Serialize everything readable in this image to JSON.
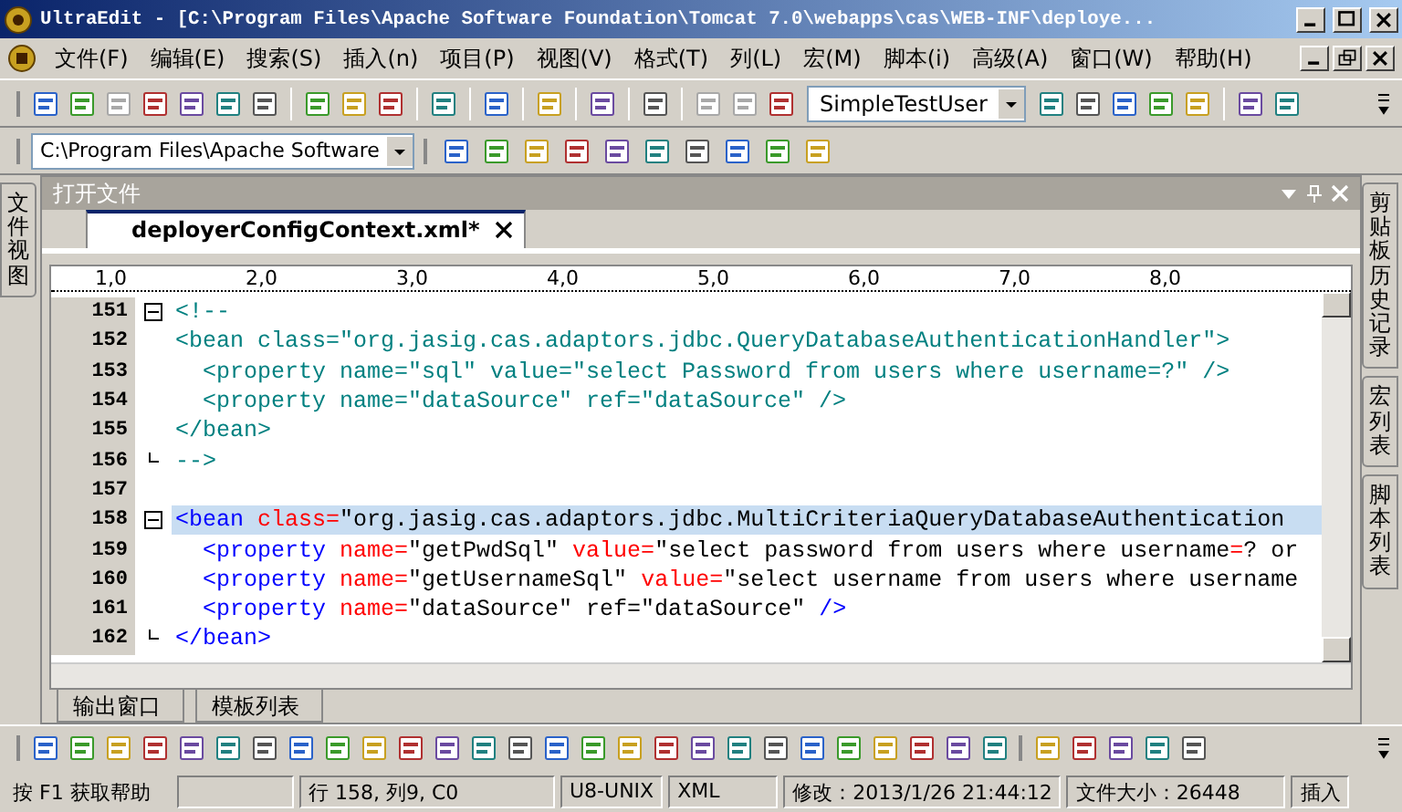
{
  "window": {
    "title": "UltraEdit - [C:\\Program Files\\Apache Software Foundation\\Tomcat 7.0\\webapps\\cas\\WEB-INF\\deploye..."
  },
  "menu": [
    "文件(F)",
    "编辑(E)",
    "搜索(S)",
    "插入(n)",
    "项目(P)",
    "视图(V)",
    "格式(T)",
    "列(L)",
    "宏(M)",
    "脚本(i)",
    "高级(A)",
    "窗口(W)",
    "帮助(H)"
  ],
  "toolbar": {
    "user_dropdown": "SimpleTestUser",
    "path_dropdown": "C:\\Program Files\\Apache Software"
  },
  "left_panel_tabs": [
    {
      "label": "文件视图",
      "selected": false
    }
  ],
  "right_panel_tabs": [
    {
      "label": "剪贴板历史记录",
      "selected": false
    },
    {
      "label": "宏列表",
      "selected": false
    },
    {
      "label": "脚本列表",
      "selected": false
    }
  ],
  "open_files_panel": {
    "title": "打开文件",
    "tabs": [
      {
        "label": "deployerConfigContext.xml*",
        "selected": true
      }
    ]
  },
  "ruler": [
    "1,0",
    "2,0",
    "3,0",
    "4,0",
    "5,0",
    "6,0",
    "7,0",
    "8,0"
  ],
  "editor": {
    "lines": [
      {
        "number": "151",
        "kind": "fold_start",
        "current": false,
        "tokens": [
          {
            "kind": "comment",
            "text": "<!--"
          }
        ]
      },
      {
        "number": "152",
        "kind": "plain",
        "current": false,
        "tokens": [
          {
            "kind": "comment",
            "text": "<bean class=\"org.jasig.cas.adaptors.jdbc.QueryDatabaseAuthenticationHandler\">"
          }
        ]
      },
      {
        "number": "153",
        "kind": "plain",
        "current": false,
        "tokens": [
          {
            "kind": "comment",
            "text": "  <property name=\"sql\" value=\"select Password from users where username=?\" />"
          }
        ]
      },
      {
        "number": "154",
        "kind": "plain",
        "current": false,
        "tokens": [
          {
            "kind": "comment",
            "text": "  <property name=\"dataSource\" ref=\"dataSource\" />"
          }
        ]
      },
      {
        "number": "155",
        "kind": "plain",
        "current": false,
        "tokens": [
          {
            "kind": "comment",
            "text": "</bean>"
          }
        ]
      },
      {
        "number": "156",
        "kind": "fold_end",
        "current": false,
        "tokens": [
          {
            "kind": "comment",
            "text": "-->"
          }
        ]
      },
      {
        "number": "157",
        "kind": "plain",
        "current": false
      },
      {
        "number": "158",
        "kind": "fold_start",
        "current": true,
        "tokens": [
          {
            "kind": "tag",
            "text": "<bean "
          },
          {
            "kind": "attr",
            "text": "class="
          },
          {
            "kind": "value",
            "text": "\"org.jasig.cas.adaptors.jdbc.MultiCriteriaQueryDatabaseAuthentication"
          }
        ]
      },
      {
        "number": "159",
        "kind": "plain",
        "current": false,
        "tokens": [
          {
            "kind": "tag",
            "text": "  <property "
          },
          {
            "kind": "attr",
            "text": "name="
          },
          {
            "kind": "value",
            "text": "\"getPwdSql\" "
          },
          {
            "kind": "attr",
            "text": "value="
          },
          {
            "kind": "value",
            "text": "\"select password from users where username"
          },
          {
            "kind": "attr",
            "text": "="
          },
          {
            "kind": "value",
            "text": "? or"
          }
        ]
      },
      {
        "number": "160",
        "kind": "plain",
        "current": false,
        "tokens": [
          {
            "kind": "tag",
            "text": "  <property "
          },
          {
            "kind": "attr",
            "text": "name="
          },
          {
            "kind": "value",
            "text": "\"getUsernameSql\" "
          },
          {
            "kind": "attr",
            "text": "value="
          },
          {
            "kind": "value",
            "text": "\"select username from users where username"
          }
        ]
      },
      {
        "number": "161",
        "kind": "plain",
        "current": false,
        "tokens": [
          {
            "kind": "tag",
            "text": "  <property "
          },
          {
            "kind": "attr",
            "text": "name="
          },
          {
            "kind": "value",
            "text": "\"dataSource\" ref=\"dataSource\" "
          },
          {
            "kind": "tag",
            "text": "/>"
          }
        ]
      },
      {
        "number": "162",
        "kind": "fold_end",
        "current": false,
        "tokens": [
          {
            "kind": "tag",
            "text": "</bean>"
          }
        ]
      }
    ]
  },
  "bottom_tabs": [
    {
      "label": "输出窗口",
      "selected": false
    },
    {
      "label": "模板列表",
      "selected": false
    }
  ],
  "status_bar": [
    "按 F1 获取帮助",
    "行 158, 列9, C0",
    "U8-UNIX",
    "XML",
    "修改：2013/1/26 21:44:12",
    "文件大小：26448",
    "插入"
  ]
}
